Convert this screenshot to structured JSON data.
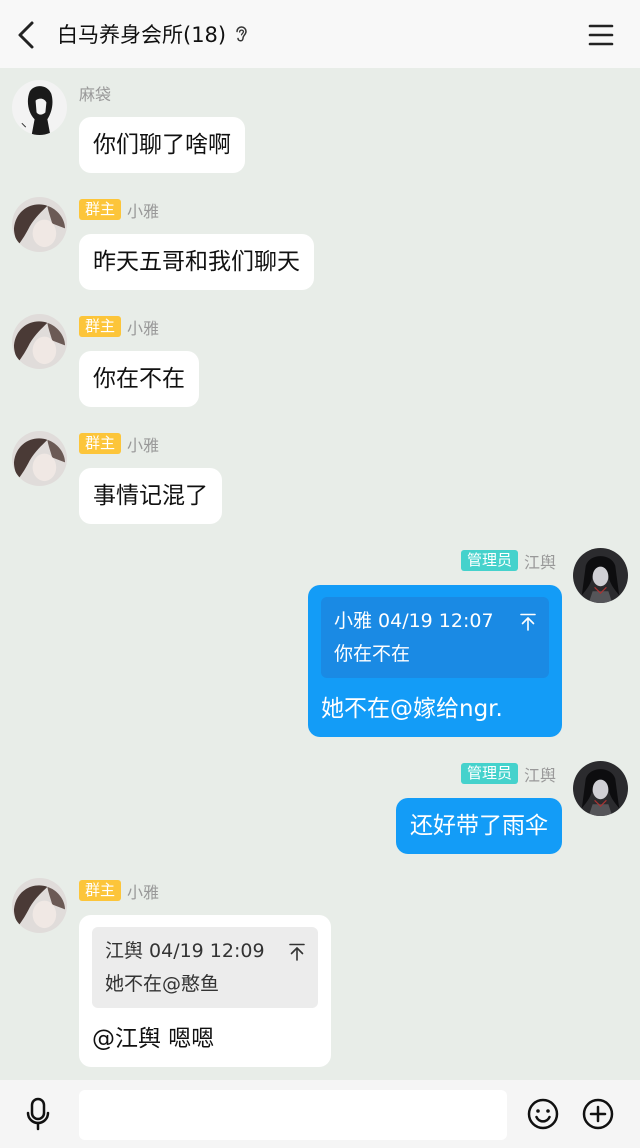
{
  "header": {
    "title": "白马养身会所(18)",
    "back_icon": "back-arrow-icon",
    "ear_icon": "ear-icon",
    "menu_icon": "menu-icon"
  },
  "messages": [
    {
      "sender": "麻袋",
      "text": "你们聊了啥啊"
    },
    {
      "badge": "群主",
      "sender": "小雅",
      "text": "昨天五哥和我们聊天"
    },
    {
      "badge": "群主",
      "sender": "小雅",
      "text": "你在不在"
    },
    {
      "badge": "群主",
      "sender": "小雅",
      "text": "事情记混了"
    },
    {
      "badge": "管理员",
      "sender": "江舆",
      "quote": {
        "sender": "小雅",
        "time": "04/19 12:07",
        "text": "你在不在"
      },
      "text": "她不在@嫁给ngr."
    },
    {
      "badge": "管理员",
      "sender": "江舆",
      "text": "还好带了雨伞"
    },
    {
      "badge": "群主",
      "sender": "小雅",
      "quote": {
        "sender": "江舆",
        "time": "04/19 12:09",
        "text": "她不在@憨鱼"
      },
      "text": "@江舆 嗯嗯"
    }
  ],
  "input_bar": {
    "value": "",
    "placeholder": "",
    "mic_icon": "microphone-icon",
    "emoji_icon": "emoji-icon",
    "plus_icon": "plus-icon"
  },
  "colors": {
    "chat_background": "#e8ede8",
    "header_background": "#f8f8f8",
    "outgoing_bubble": "#139cf7",
    "outgoing_quote": "#1a8ae4",
    "incoming_bubble": "#ffffff",
    "incoming_quote": "#ececec",
    "owner_badge": "#fcc53a",
    "admin_badge": "#45d2cc",
    "sender_name": "#999999"
  }
}
